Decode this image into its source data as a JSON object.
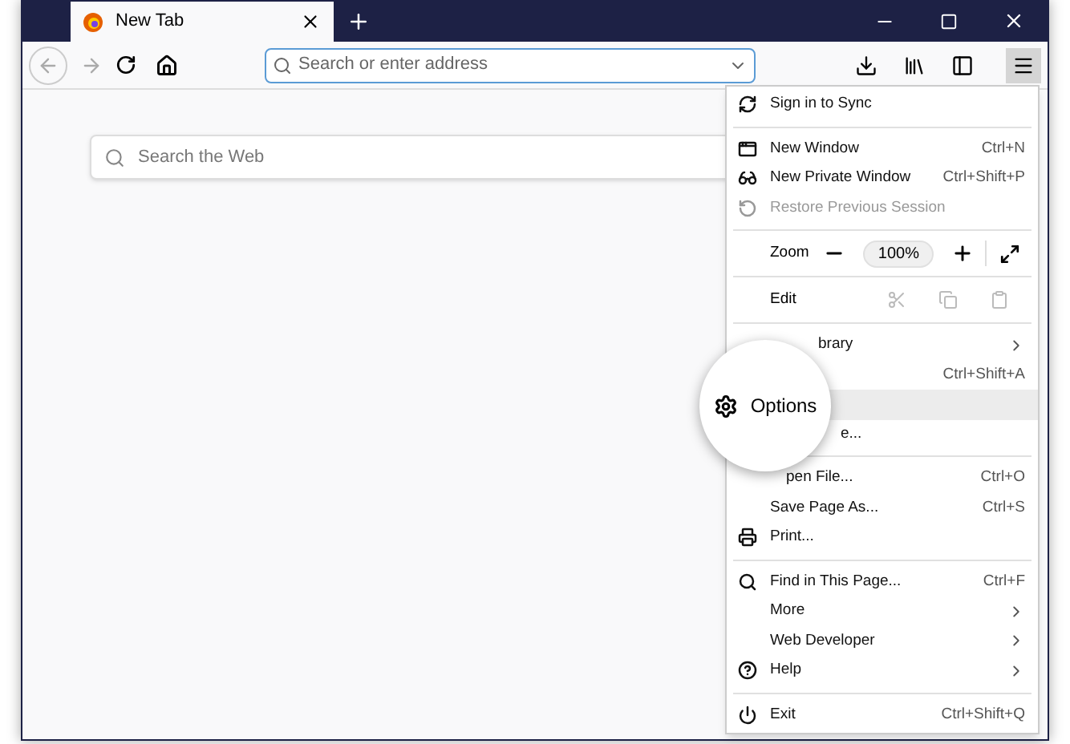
{
  "tab": {
    "title": "New Tab",
    "selected": true
  },
  "toolbar": {
    "address_placeholder": "Search or enter address"
  },
  "page": {
    "search_placeholder": "Search the Web"
  },
  "magnifier": {
    "label": "Options"
  },
  "menu": [
    {
      "kind": "item",
      "label": "Sign in to Sync",
      "disabled": false,
      "selected": false
    },
    {
      "kind": "separator"
    },
    {
      "kind": "item",
      "label": "New Window",
      "shortcut": "Ctrl+N",
      "disabled": false,
      "selected": false
    },
    {
      "kind": "item",
      "label": "New Private Window",
      "shortcut": "Ctrl+Shift+P",
      "disabled": false,
      "selected": false
    },
    {
      "kind": "item",
      "label": "Restore Previous Session",
      "disabled": true,
      "selected": false
    },
    {
      "kind": "separator"
    },
    {
      "kind": "zoom",
      "label": "Zoom",
      "value": "100%"
    },
    {
      "kind": "separator"
    },
    {
      "kind": "edit",
      "label": "Edit"
    },
    {
      "kind": "separator"
    },
    {
      "kind": "item",
      "label": "brary",
      "submenu": true,
      "disabled": false,
      "selected": false
    },
    {
      "kind": "item",
      "shortcut": "Ctrl+Shift+A",
      "disabled": false,
      "selected": false
    },
    {
      "kind": "item",
      "disabled": false,
      "selected": true
    },
    {
      "kind": "item",
      "label": "e...",
      "disabled": false,
      "selected": false
    },
    {
      "kind": "separator"
    },
    {
      "kind": "item",
      "label": "pen File...",
      "shortcut": "Ctrl+O",
      "disabled": false,
      "selected": false
    },
    {
      "kind": "item",
      "label": "Save Page As...",
      "shortcut": "Ctrl+S",
      "disabled": false,
      "selected": false
    },
    {
      "kind": "item",
      "label": "Print...",
      "disabled": false,
      "selected": false
    },
    {
      "kind": "separator"
    },
    {
      "kind": "item",
      "label": "Find in This Page...",
      "shortcut": "Ctrl+F",
      "disabled": false,
      "selected": false
    },
    {
      "kind": "item",
      "label": "More",
      "submenu": true,
      "disabled": false,
      "selected": false
    },
    {
      "kind": "item",
      "label": "Web Developer",
      "submenu": true,
      "disabled": false,
      "selected": false
    },
    {
      "kind": "item",
      "label": "Help",
      "submenu": true,
      "disabled": false,
      "selected": false
    },
    {
      "kind": "separator"
    },
    {
      "kind": "item",
      "label": "Exit",
      "shortcut": "Ctrl+Shift+Q",
      "disabled": false,
      "selected": false
    }
  ]
}
